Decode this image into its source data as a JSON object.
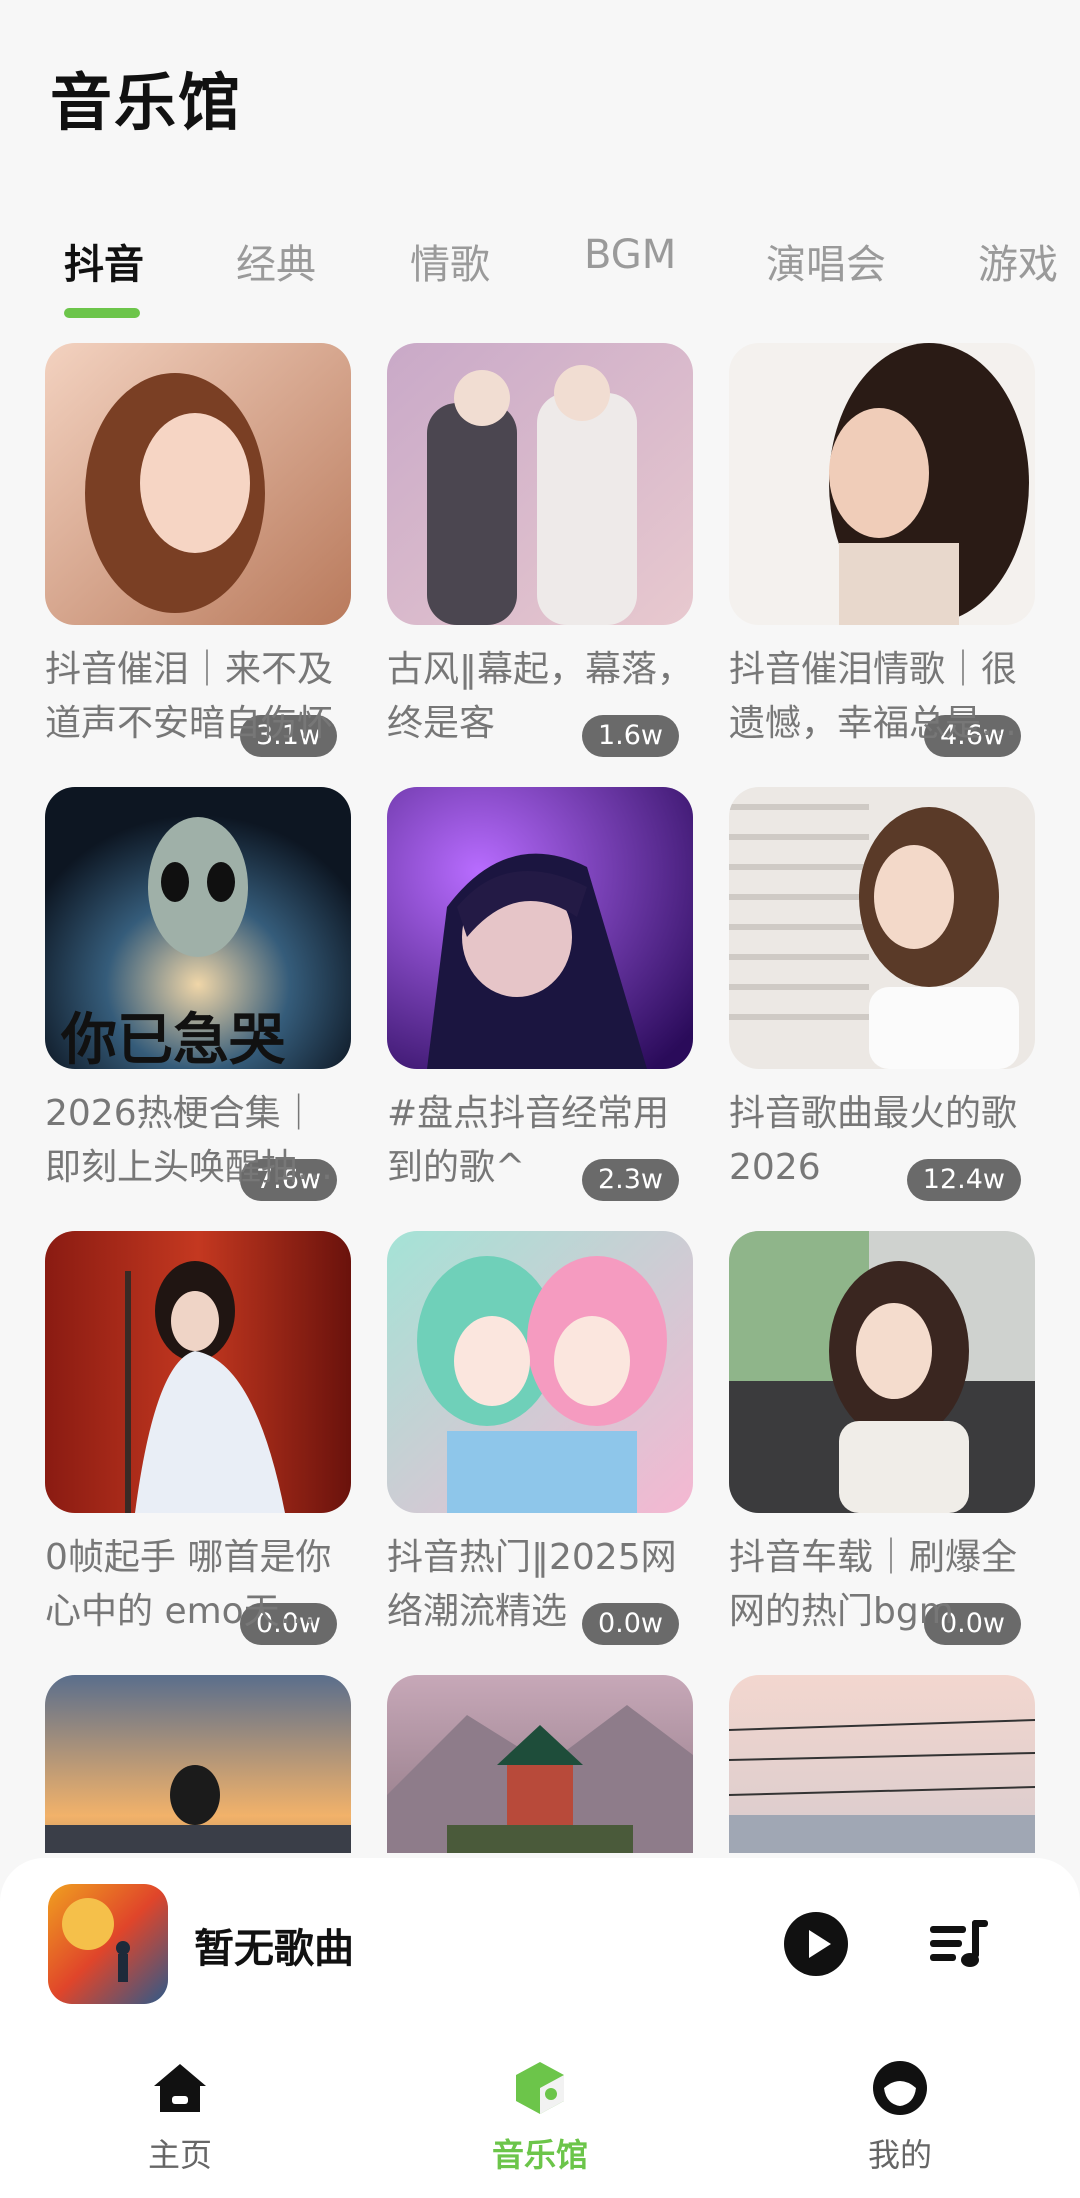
{
  "header": {
    "title": "音乐馆"
  },
  "tabs": [
    {
      "label": "抖音",
      "active": true
    },
    {
      "label": "经典"
    },
    {
      "label": "情歌"
    },
    {
      "label": "BGM"
    },
    {
      "label": "演唱会"
    },
    {
      "label": "游戏"
    }
  ],
  "playlists": [
    {
      "title": "抖音催泪｜来不及道声不安暗自伤怀",
      "count": "3.1w"
    },
    {
      "title": "古风‖幕起，幕落，终是客",
      "count": "1.6w"
    },
    {
      "title": "抖音催泪情歌｜很遗憾，幸福总是…",
      "count": "4.6w"
    },
    {
      "title": "2026热梗合集｜即刻上头唤醒抽…",
      "count": "7.6w"
    },
    {
      "title": "#盘点抖音经常用到的歌^",
      "count": "2.3w"
    },
    {
      "title": "抖音歌曲最火的歌2026",
      "count": "12.4w"
    },
    {
      "title": "0帧起手 哪首是你心中的 emo天…",
      "count": "0.0w"
    },
    {
      "title": "抖音热门‖2025网络潮流精选",
      "count": "0.0w"
    },
    {
      "title": "抖音车载｜刷爆全网的热门bgm",
      "count": "0.0w"
    },
    {
      "title": "",
      "count": ""
    },
    {
      "title": "",
      "count": ""
    },
    {
      "title": "",
      "count": ""
    }
  ],
  "thumb_overlay_text": "你已急哭",
  "player": {
    "song": "暂无歌曲"
  },
  "nav": [
    {
      "label": "主页",
      "icon": "home-icon"
    },
    {
      "label": "音乐馆",
      "icon": "music-hall-icon",
      "active": true
    },
    {
      "label": "我的",
      "icon": "profile-icon"
    }
  ],
  "colors": {
    "accent": "#6cc54a",
    "background": "#f7f7f7",
    "text": "#111111",
    "muted": "#777777"
  }
}
